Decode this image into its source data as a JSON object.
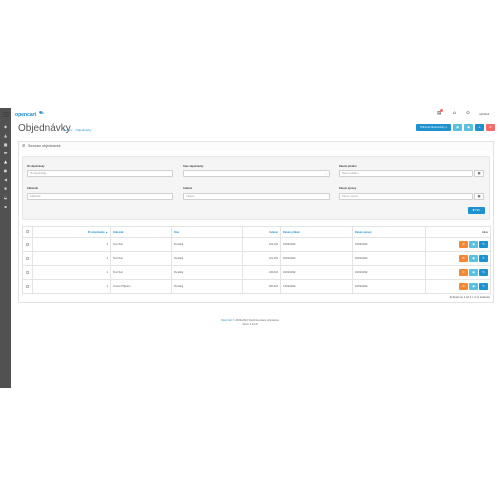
{
  "brand": {
    "logo_text": "opencart"
  },
  "header": {
    "user_label": "odhlásit"
  },
  "page": {
    "title": "Objednávky",
    "breadcrumb": [
      "Domov",
      "Objednávky"
    ]
  },
  "toolbar": {
    "primary_label": "Filtrovat Objednávky"
  },
  "panel": {
    "title": "Seznam objednávek"
  },
  "filter": {
    "order_id_label": "ID objednávky",
    "order_id_placeholder": "ID objednávky",
    "status_label": "Stav objednávky",
    "status_value": "",
    "date_added_label": "Datum přidání",
    "date_added_placeholder": "Datum přidání",
    "customer_label": "Zákazník",
    "customer_placeholder": "Zákazník",
    "total_label": "Celkem",
    "total_placeholder": "Celkem",
    "date_modified_label": "Datum úpravy",
    "date_modified_placeholder": "Datum úpravy",
    "filter_button": "Filtr"
  },
  "table": {
    "headers": {
      "order_id": "ID objednávky ▲",
      "customer": "Zákazník",
      "status": "Stav",
      "total": "Celkem",
      "date_added": "Datum přidání",
      "date_modified": "Datum úpravy",
      "action": "Akce"
    },
    "rows": [
      {
        "order_id": "4",
        "customer": "Test Test",
        "status": "Pending",
        "total": "121,1Kč",
        "date_added": "16/02/2022",
        "date_modified": "16/02/2022"
      },
      {
        "order_id": "3",
        "customer": "Test Test",
        "status": "Pending",
        "total": "121,1Kč",
        "date_added": "16/02/2022",
        "date_modified": "16/02/2022"
      },
      {
        "order_id": "2",
        "customer": "Test Test",
        "status": "Pending",
        "total": "145,2Kč",
        "date_added": "16/02/2022",
        "date_modified": "16/02/2022"
      },
      {
        "order_id": "1",
        "customer": "Jméno Příjmení",
        "status": "Pending",
        "total": "156,3Kč",
        "date_added": "14/02/2022",
        "date_modified": "16/02/2022"
      }
    ]
  },
  "pagination": {
    "text": "Zobrazeno 1 až 4 z 4 (1 stránek)"
  },
  "footer": {
    "line1_link": "OpenCart",
    "line1_rest": " © 2009-2022 Všechna práva vyhrazena.",
    "line2": "Verze 3.0.3.8"
  },
  "colors": {
    "accent": "#1e91cf",
    "info": "#5bc0de",
    "danger": "#f56b6b",
    "warning": "#f38733",
    "sidebar": "#515151"
  }
}
